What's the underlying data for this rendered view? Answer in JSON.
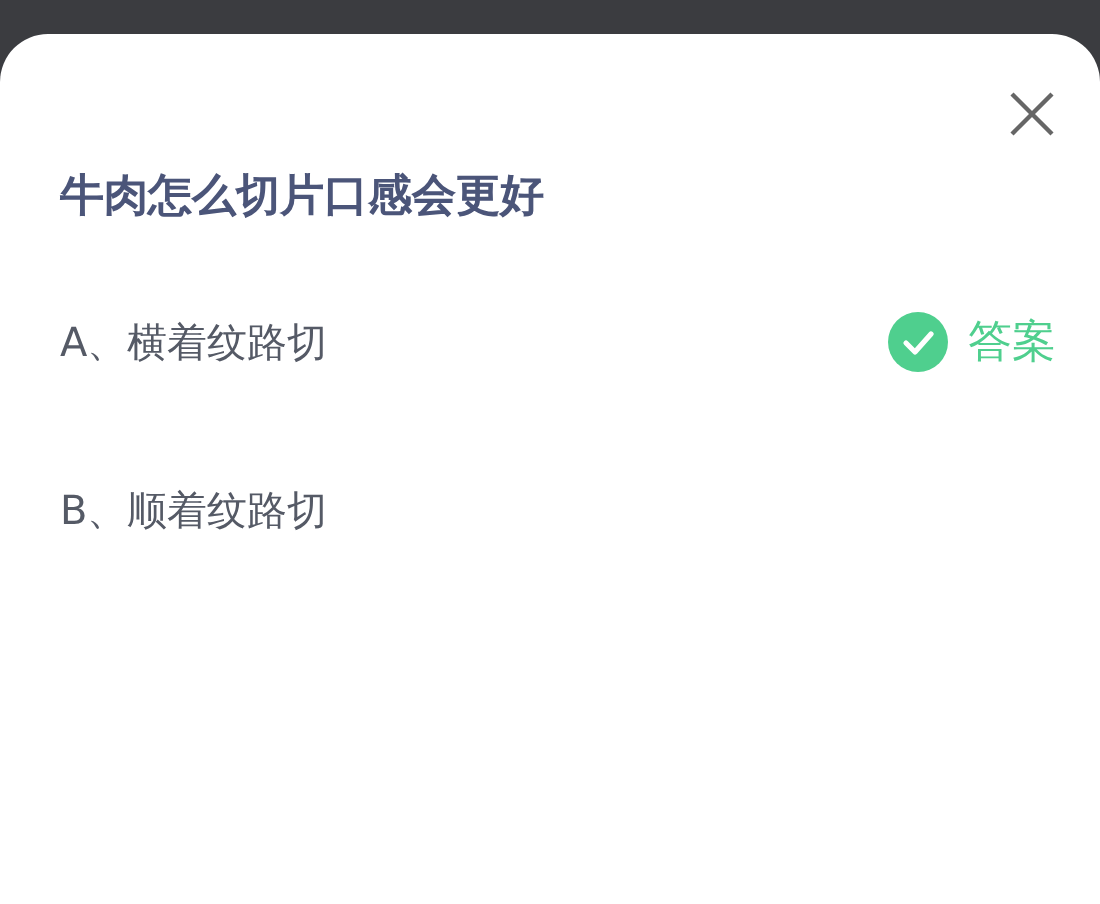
{
  "question": "牛肉怎么切片口感会更好",
  "options": [
    {
      "label": "A、横着纹路切",
      "correct": true
    },
    {
      "label": "B、顺着纹路切",
      "correct": false
    }
  ],
  "answer_label": "答案"
}
